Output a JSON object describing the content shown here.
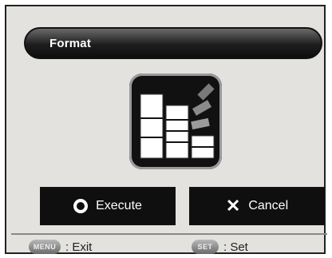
{
  "title": "Format",
  "buttons": {
    "execute_label": "Execute",
    "cancel_label": "Cancel"
  },
  "footer": {
    "exit_key": "MENU",
    "exit_text": ": Exit",
    "set_key": "SET",
    "set_text": ": Set"
  },
  "icons": {
    "title_icon": "none",
    "format_icon": "format-card-icon",
    "execute_icon": "ring-icon",
    "cancel_icon": "x-icon"
  }
}
